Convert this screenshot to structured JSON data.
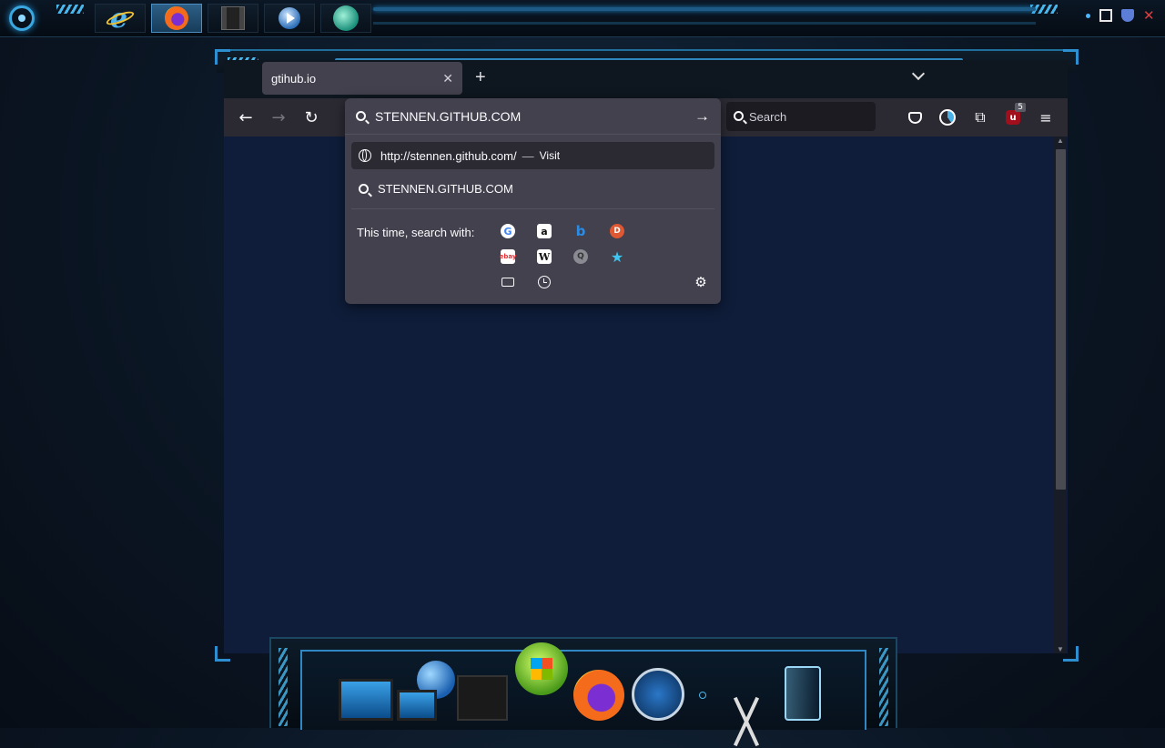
{
  "taskbar": {
    "apps": [
      {
        "name": "internet-explorer",
        "icon": "ie-icon",
        "active": false
      },
      {
        "name": "firefox",
        "icon": "firefox-icon",
        "active": true
      },
      {
        "name": "film",
        "icon": "film-icon",
        "active": false
      },
      {
        "name": "media-player",
        "icon": "play-icon",
        "active": false
      },
      {
        "name": "globe-app",
        "icon": "globe-icon",
        "active": false
      }
    ]
  },
  "browser": {
    "tab_title": "gtihub.io",
    "tab_close": "✕",
    "new_tab": "+",
    "nav": {
      "back": "←",
      "forward": "→",
      "reload": "↻"
    },
    "search_placeholder": "Search",
    "extensions_badge": "5",
    "ublock_label": "u"
  },
  "urlbar": {
    "value": "STENNEN.GITHUB.COM",
    "go": "→",
    "results": [
      {
        "text": "http://stennen.github.com/",
        "dash": "—",
        "action": "Visit"
      },
      {
        "text": "STENNEN.GITHUB.COM"
      }
    ],
    "engines_label": "This time, search with:",
    "engines": {
      "google": "G",
      "amazon": "a",
      "bing": "b",
      "duckduckgo": "D",
      "ebay": "ebay",
      "wikipedia": "W",
      "search": "Q",
      "star": "★"
    }
  },
  "colors": {
    "accent": "#2f88c4",
    "panel": "#42414d",
    "toolbar": "#2b2a33",
    "content": "#0f1d3a"
  }
}
